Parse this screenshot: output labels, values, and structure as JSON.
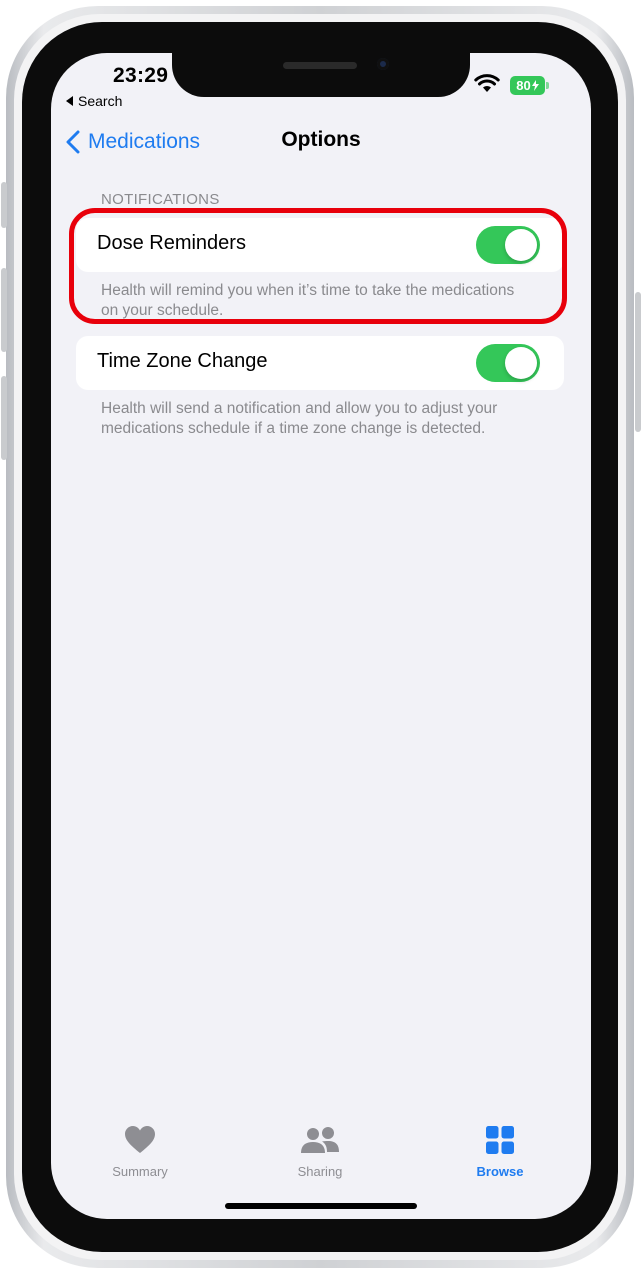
{
  "status_bar": {
    "time": "23:29",
    "back_app": "Search",
    "battery": "80"
  },
  "nav": {
    "back_label": "Medications",
    "title": "Options"
  },
  "notifications": {
    "header": "NOTIFICATIONS",
    "dose_reminders": {
      "label": "Dose Reminders",
      "enabled": true,
      "footer": "Health will remind you when it’s time to take the medications on your schedule."
    },
    "time_zone_change": {
      "label": "Time Zone Change",
      "enabled": true,
      "footer": "Health will send a notification and allow you to adjust your medications schedule if a time zone change is detected."
    }
  },
  "tab_bar": {
    "items": [
      {
        "label": "Summary",
        "icon": "heart-icon",
        "selected": false
      },
      {
        "label": "Sharing",
        "icon": "people-icon",
        "selected": false
      },
      {
        "label": "Browse",
        "icon": "grid-icon",
        "selected": true
      }
    ]
  },
  "colors": {
    "accent": "#1f7cf0",
    "toggle_on": "#34c759",
    "highlight": "#e8000b",
    "background": "#f2f2f7",
    "inactive_tab": "#8e8e93"
  }
}
